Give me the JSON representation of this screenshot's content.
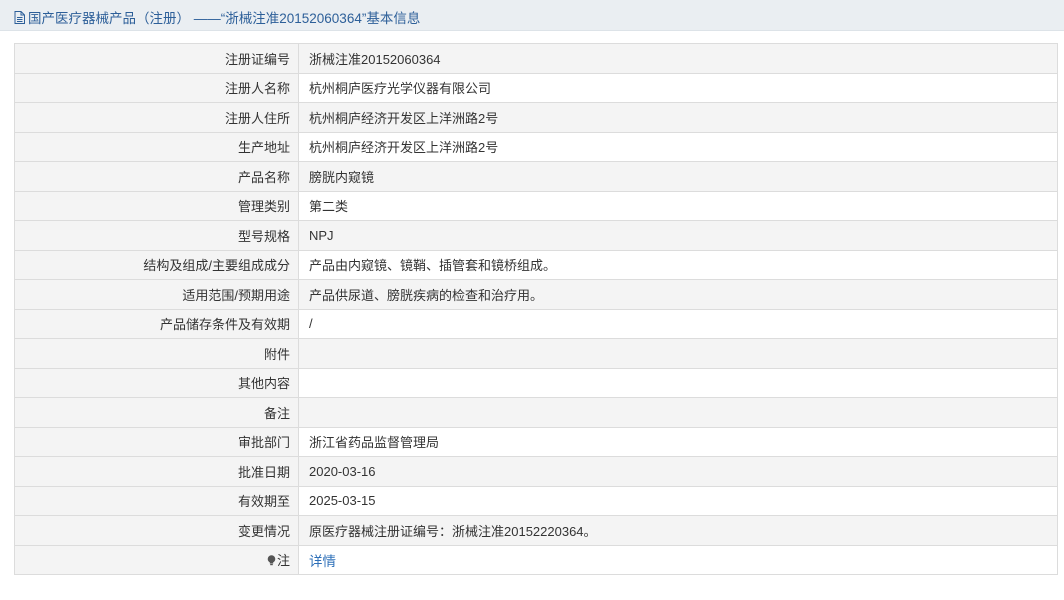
{
  "header": {
    "title": "国产医疗器械产品（注册） ——“浙械注准20152060364”基本信息",
    "icon": "document-icon"
  },
  "rows": [
    {
      "label": "注册证编号",
      "value": "浙械注准20152060364"
    },
    {
      "label": "注册人名称",
      "value": "杭州桐庐医疗光学仪器有限公司"
    },
    {
      "label": "注册人住所",
      "value": "杭州桐庐经济开发区上洋洲路2号"
    },
    {
      "label": "生产地址",
      "value": "杭州桐庐经济开发区上洋洲路2号"
    },
    {
      "label": "产品名称",
      "value": "膀胱内窥镜"
    },
    {
      "label": "管理类别",
      "value": "第二类"
    },
    {
      "label": "型号规格",
      "value": "NPJ"
    },
    {
      "label": "结构及组成/主要组成成分",
      "value": "产品由内窥镜、镜鞘、插管套和镜桥组成。"
    },
    {
      "label": "适用范围/预期用途",
      "value": "产品供尿道、膀胱疾病的检查和治疗用。"
    },
    {
      "label": "产品储存条件及有效期",
      "value": "/"
    },
    {
      "label": "附件",
      "value": ""
    },
    {
      "label": "其他内容",
      "value": ""
    },
    {
      "label": "备注",
      "value": ""
    },
    {
      "label": "审批部门",
      "value": "浙江省药品监督管理局"
    },
    {
      "label": "批准日期",
      "value": "2020-03-16"
    },
    {
      "label": "有效期至",
      "value": "2025-03-15"
    },
    {
      "label": "变更情况",
      "value": "原医疗器械注册证编号：浙械注准20152220364。"
    }
  ],
  "note": {
    "label": "注",
    "icon": "lightbulb-icon",
    "link_text": "详情"
  },
  "colors": {
    "header_bg": "#eaeef2",
    "header_text": "#2d5f99",
    "label_bg": "#f4f4f4",
    "border": "#dcdcdc",
    "link": "#2d6fb8"
  }
}
